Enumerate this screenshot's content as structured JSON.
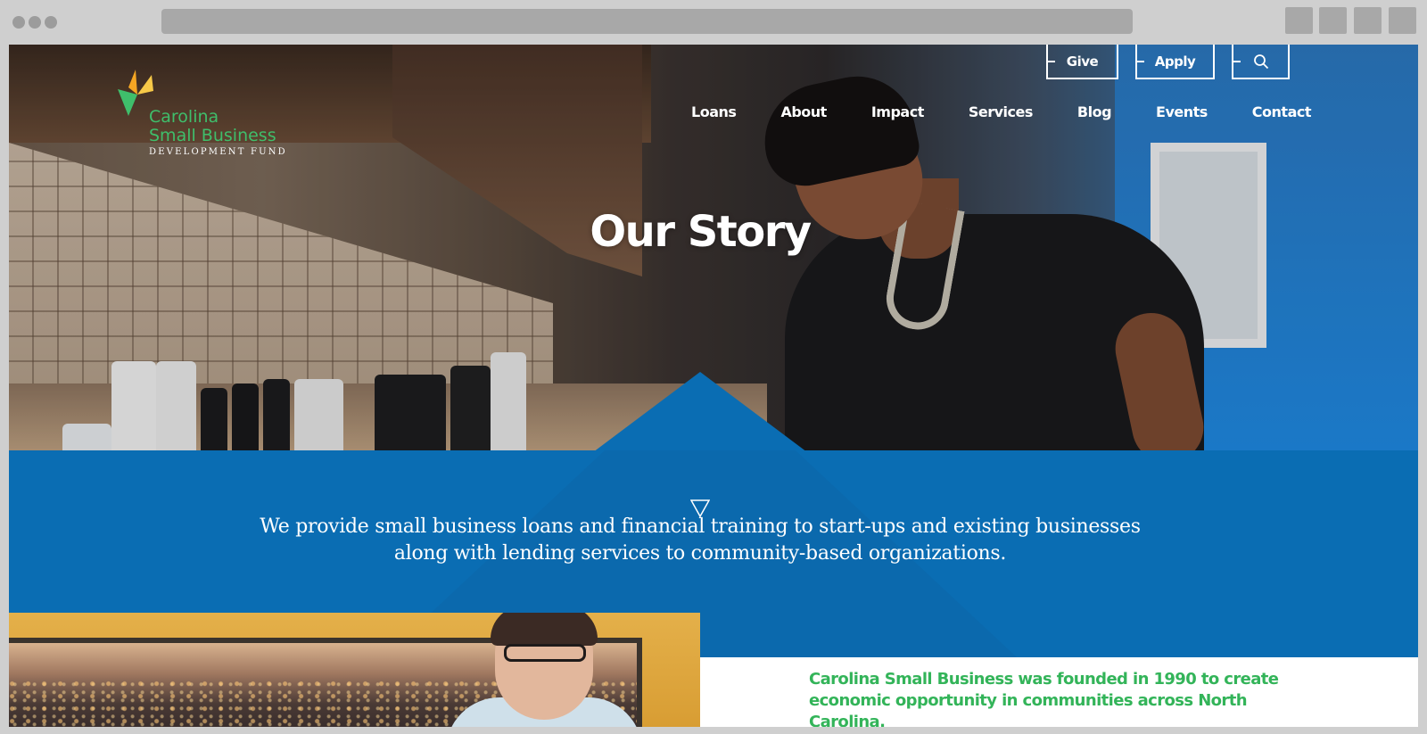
{
  "browser": {
    "window_buttons": 3,
    "toolbar_buttons": 4
  },
  "site": {
    "logo": {
      "line1": "Carolina",
      "line2": "Small Business",
      "line3": "DEVELOPMENT FUND",
      "colors": {
        "green": "#3fbe6b",
        "orange": "#f5a623",
        "yellow": "#f7c948"
      }
    },
    "utility": {
      "give_label": "Give",
      "apply_label": "Apply",
      "search_icon": "search-icon"
    },
    "nav": [
      {
        "label": "Loans"
      },
      {
        "label": "About"
      },
      {
        "label": "Impact"
      },
      {
        "label": "Services"
      },
      {
        "label": "Blog"
      },
      {
        "label": "Events"
      },
      {
        "label": "Contact"
      }
    ],
    "hero": {
      "title": "Our Story"
    },
    "band": {
      "arrow_icon": "triangle-down-icon",
      "line1": "We provide small business loans and financial training to start-ups and existing businesses",
      "line2": "along with lending services to community-based organizations.",
      "color": "#0a6db3"
    },
    "about": {
      "line1": "Carolina Small Business was founded in 1990 to create",
      "line2": "economic opportunity in communities across North Carolina.",
      "color": "#33b459"
    }
  }
}
